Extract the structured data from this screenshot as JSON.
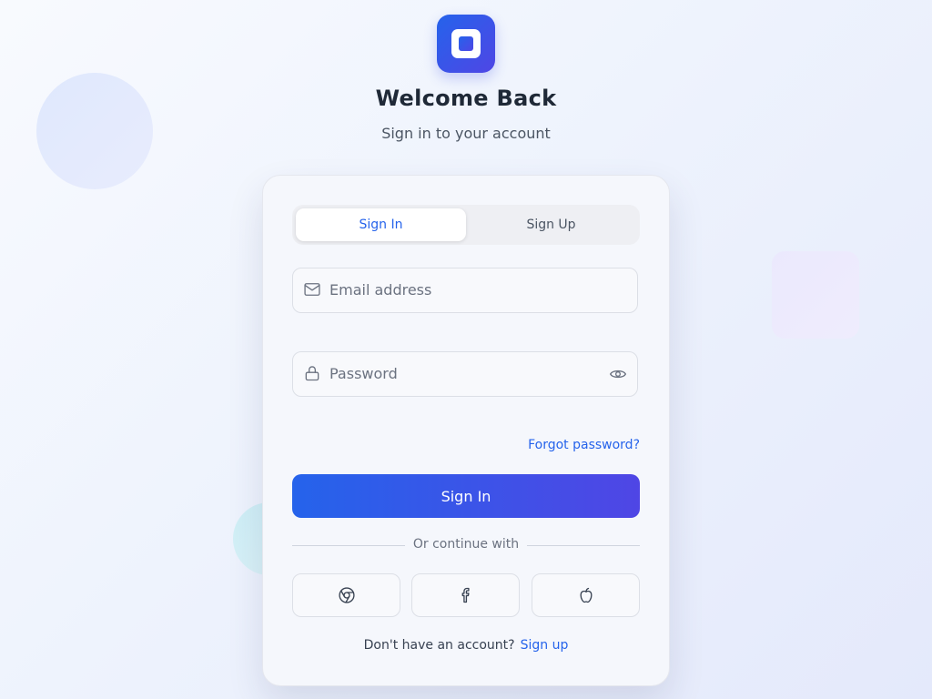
{
  "header": {
    "title": "Welcome Back",
    "subtitle": "Sign in to your account"
  },
  "tabs": [
    {
      "label": "Sign In",
      "active": true
    },
    {
      "label": "Sign Up",
      "active": false
    }
  ],
  "form": {
    "email": {
      "placeholder": "Email address",
      "value": "",
      "icon": "mail-icon"
    },
    "password": {
      "placeholder": "Password",
      "value": "",
      "icon": "lock-icon",
      "toggle_icon": "eye-icon"
    },
    "forgot_label": "Forgot password?",
    "submit_label": "Sign In"
  },
  "divider_text": "Or continue with",
  "social": [
    {
      "name": "google",
      "icon": "chrome-icon"
    },
    {
      "name": "facebook",
      "icon": "facebook-icon"
    },
    {
      "name": "apple",
      "icon": "apple-icon"
    }
  ],
  "footer": {
    "prompt": "Don't have an account?",
    "link_label": "Sign up"
  },
  "colors": {
    "accent": "#2563eb",
    "accent_end": "#4f46e5",
    "text_primary": "#1f2937",
    "text_secondary": "#4b5563"
  }
}
